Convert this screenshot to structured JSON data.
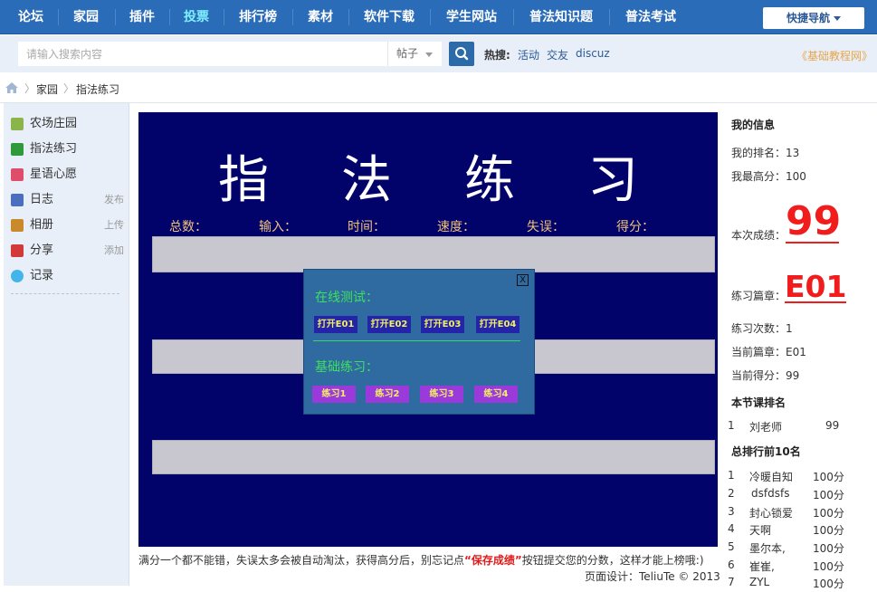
{
  "nav": {
    "items": [
      "论坛",
      "家园",
      "插件",
      "投票",
      "排行榜",
      "素材",
      "软件下载",
      "学生网站",
      "普法知识题",
      "普法考试"
    ],
    "active_index": 3,
    "quick_nav": "快捷导航"
  },
  "search": {
    "placeholder": "请输入搜索内容",
    "type": "帖子",
    "hot_label": "热搜:",
    "hot_terms": [
      "活动",
      "交友",
      "discuz"
    ],
    "tutorial_link": "《基础教程网》"
  },
  "breadcrumb": [
    "家园",
    "指法练习"
  ],
  "sidebar": {
    "items": [
      {
        "label": "农场庄园",
        "action": "",
        "icon": "farm-icon",
        "color": "#8bb54a"
      },
      {
        "label": "指法练习",
        "action": "",
        "icon": "keyboard-icon",
        "color": "#2e9a3a"
      },
      {
        "label": "星语心愿",
        "action": "",
        "icon": "heart-icon",
        "color": "#e04d6b"
      },
      {
        "label": "日志",
        "action": "发布",
        "icon": "blog-icon",
        "color": "#4a6fbf"
      },
      {
        "label": "相册",
        "action": "上传",
        "icon": "photo-icon",
        "color": "#c88a2a"
      },
      {
        "label": "分享",
        "action": "添加",
        "icon": "share-icon",
        "color": "#d23a3a"
      },
      {
        "label": "记录",
        "action": "",
        "icon": "chat-bubble-icon",
        "color": "#42b6e8"
      }
    ]
  },
  "game": {
    "title": "指法练习",
    "stats": [
      "总数：",
      "输入：",
      "时间：",
      "速度：",
      "失误：",
      "得分："
    ],
    "dialog": {
      "close": "X",
      "online_label": "在线测试：",
      "online_buttons": [
        "打开E01",
        "打开E02",
        "打开E03",
        "打开E04"
      ],
      "basic_label": "基础练习：",
      "basic_buttons": [
        "练习1",
        "练习2",
        "练习3",
        "练习4"
      ]
    }
  },
  "footer": {
    "note_before": "满分一个都不能错，失误太多会被自动淘汰，获得高分后，别忘记点",
    "note_highlight": "“保存成绩”",
    "note_after": "按钮提交您的分数，这样才能上榜哦:)",
    "credit": "页面设计：TeliuTe © 2013"
  },
  "info": {
    "heading": "我的信息",
    "my_rank": "我的排名：13",
    "best_score": "我最高分：100",
    "current_label": "本次成绩：",
    "current_score": "99",
    "chapter_label": "练习篇章：",
    "chapter": "E01",
    "practice_count": "练习次数：1",
    "current_chapter": "当前篇章：E01",
    "current_points": "当前得分：99",
    "lesson_heading": "本节课排名",
    "lesson_rank": [
      {
        "n": "1",
        "name": "刘老师",
        "score": "99"
      }
    ],
    "top_heading": "总排行前10名",
    "top": [
      {
        "n": "1",
        "name": "冷暖自知",
        "score": "100分"
      },
      {
        "n": "2",
        "name": "dsfdsfs",
        "score": "100分"
      },
      {
        "n": "3",
        "name": "封心锁爱",
        "score": "100分"
      },
      {
        "n": "4",
        "name": "天啊",
        "score": "100分"
      },
      {
        "n": "5",
        "name": "墨尔本,",
        "score": "100分"
      },
      {
        "n": "6",
        "name": "崔崔,",
        "score": "100分"
      },
      {
        "n": "7",
        "name": "ZYL",
        "score": "100分"
      }
    ]
  },
  "colors": {
    "nav_bg": "#2b6cb8",
    "game_bg": "#02026b",
    "score_red": "#f11c1c",
    "dialog_bg": "#2f6ba0"
  }
}
